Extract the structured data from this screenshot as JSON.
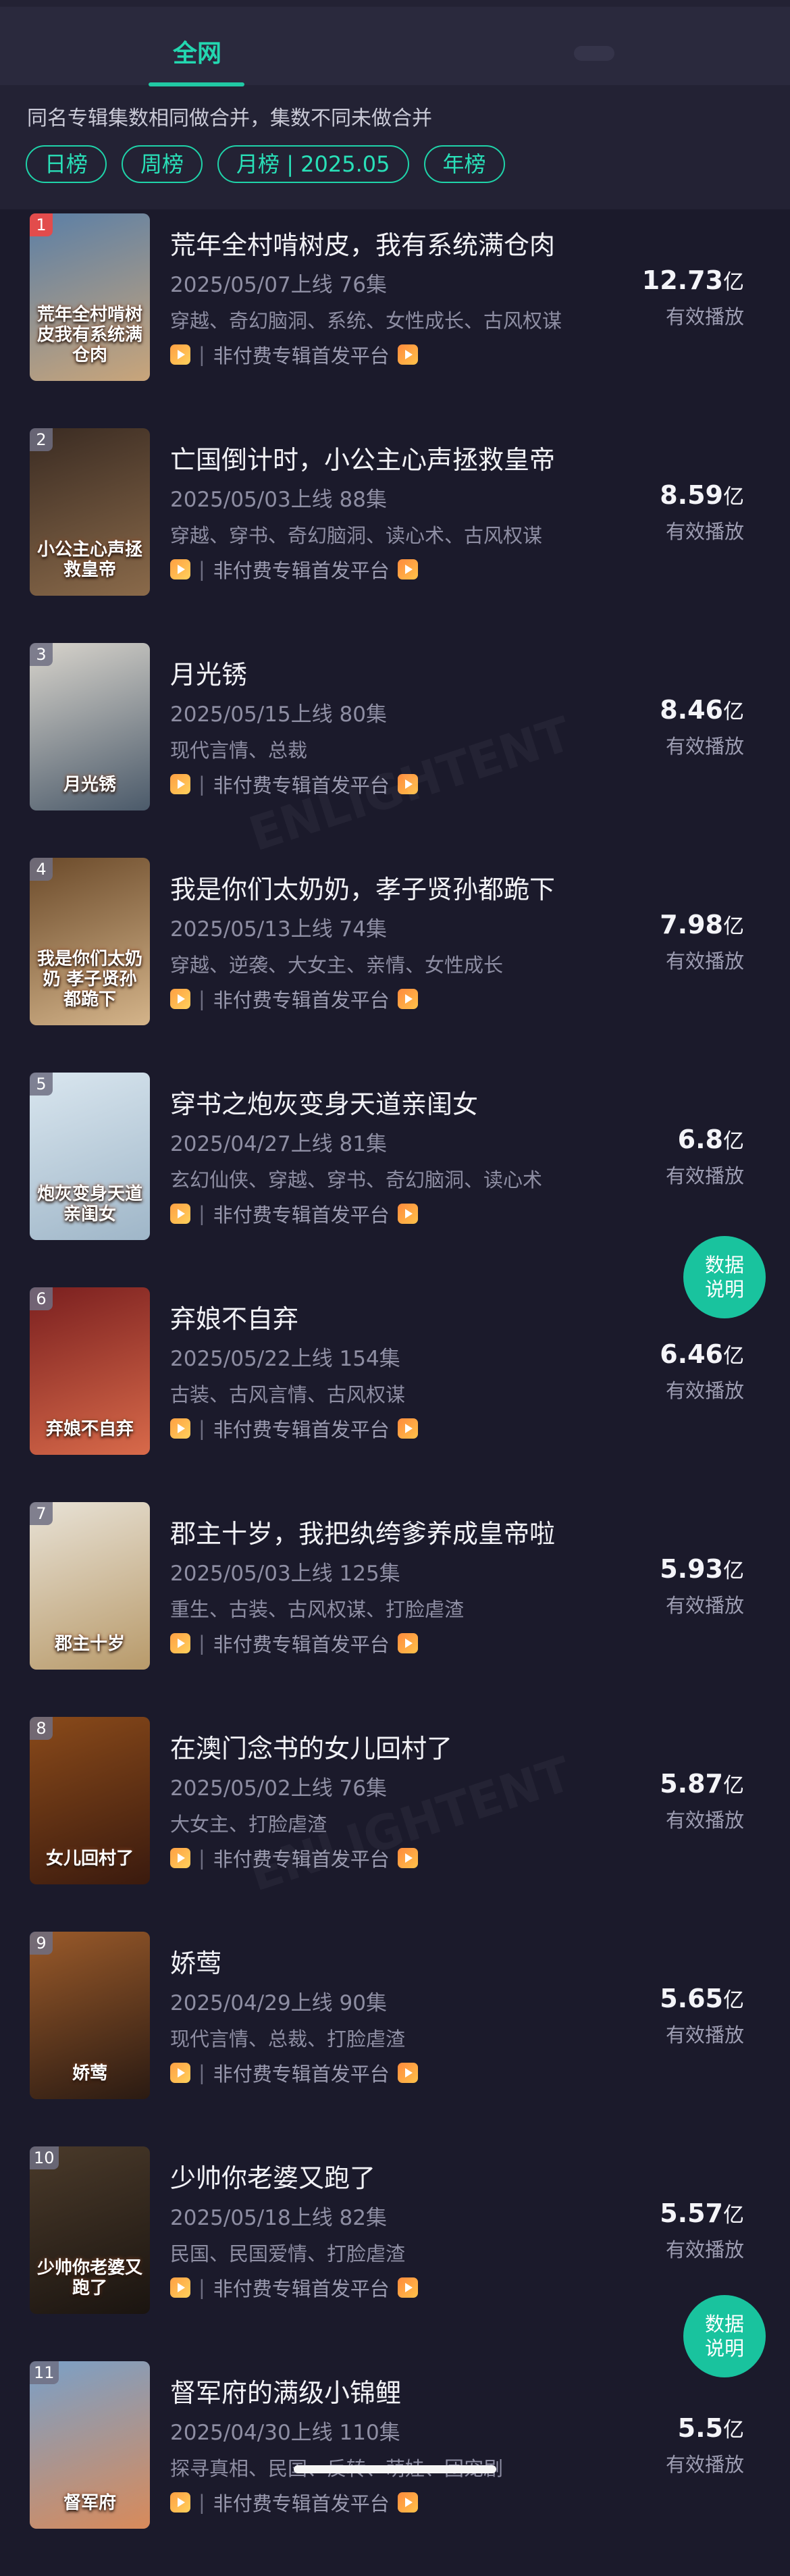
{
  "tabs": {
    "active": "全网"
  },
  "note": "同名专辑集数相同做合并，集数不同未做合并",
  "filters": [
    "日榜",
    "周榜",
    "月榜 | 2025.05",
    "年榜"
  ],
  "fab_label_line1": "数据",
  "fab_label_line2": "说明",
  "platform_text": "非付费专辑首发平台",
  "separator": "|",
  "value_label": "有效播放",
  "unit": "亿",
  "colors": {
    "accent": "#21c9a4",
    "background": "#1b1a2b",
    "header": "#232234",
    "rank_first": "#e24c4c"
  },
  "items": [
    {
      "rank": "1",
      "title": "荒年全村啃树皮，我有系统满仓肉",
      "meta": "2025/05/07上线 76集",
      "tags": "穿越、奇幻脑洞、系统、女性成长、古风权谋",
      "value": "12.73",
      "poster_text": "荒年全村啃树皮我有系统满仓肉",
      "poster_colors": [
        "#5b7fa6",
        "#c9a57a"
      ]
    },
    {
      "rank": "2",
      "title": "亡国倒计时，小公主心声拯救皇帝",
      "meta": "2025/05/03上线 88集",
      "tags": "穿越、穿书、奇幻脑洞、读心术、古风权谋",
      "value": "8.59",
      "poster_text": "小公主心声拯救皇帝",
      "poster_colors": [
        "#3a2b22",
        "#8a6a4a"
      ]
    },
    {
      "rank": "3",
      "title": "月光锈",
      "meta": "2025/05/15上线 80集",
      "tags": "现代言情、总裁",
      "value": "8.46",
      "poster_text": "月光锈",
      "poster_colors": [
        "#d8d4cc",
        "#4b5a6a"
      ]
    },
    {
      "rank": "4",
      "title": "我是你们太奶奶，孝子贤孙都跪下",
      "meta": "2025/05/13上线 74集",
      "tags": "穿越、逆袭、大女主、亲情、女性成长",
      "value": "7.98",
      "poster_text": "我是你们太奶奶 孝子贤孙都跪下",
      "poster_colors": [
        "#6b4a2a",
        "#d4b48a"
      ]
    },
    {
      "rank": "5",
      "title": "穿书之炮灰变身天道亲闺女",
      "meta": "2025/04/27上线 81集",
      "tags": "玄幻仙侠、穿越、穿书、奇幻脑洞、读心术",
      "value": "6.8",
      "poster_text": "炮灰变身天道亲闺女",
      "poster_colors": [
        "#d9e6ef",
        "#9fb6c8"
      ]
    },
    {
      "rank": "6",
      "title": "弃娘不自弃",
      "meta": "2025/05/22上线 154集",
      "tags": "古装、古风言情、古风权谋",
      "value": "6.46",
      "poster_text": "弃娘不自弃",
      "poster_colors": [
        "#7a1f1f",
        "#d86a4a"
      ]
    },
    {
      "rank": "7",
      "title": "郡主十岁，我把纨绔爹养成皇帝啦",
      "meta": "2025/05/03上线 125集",
      "tags": "重生、古装、古风权谋、打脸虐渣",
      "value": "5.93",
      "poster_text": "郡主十岁",
      "poster_colors": [
        "#e8e2d6",
        "#b89a6a"
      ]
    },
    {
      "rank": "8",
      "title": "在澳门念书的女儿回村了",
      "meta": "2025/05/02上线 76集",
      "tags": "大女主、打脸虐渣",
      "value": "5.87",
      "poster_text": "女儿回村了",
      "poster_colors": [
        "#8a4a1a",
        "#3a1a0e"
      ]
    },
    {
      "rank": "9",
      "title": "娇莺",
      "meta": "2025/04/29上线 90集",
      "tags": "现代言情、总裁、打脸虐渣",
      "value": "5.65",
      "poster_text": "娇莺",
      "poster_colors": [
        "#9a5a2a",
        "#2a1a12"
      ]
    },
    {
      "rank": "10",
      "title": "少帅你老婆又跑了",
      "meta": "2025/05/18上线 82集",
      "tags": "民国、民国爱情、打脸虐渣",
      "value": "5.57",
      "poster_text": "少帅你老婆又跑了",
      "poster_colors": [
        "#4a3a2a",
        "#1a1410"
      ]
    },
    {
      "rank": "11",
      "title": "督军府的满级小锦鲤",
      "meta": "2025/04/30上线 110集",
      "tags": "探寻真相、民国、反转、萌娃、团宠剧",
      "value": "5.5",
      "poster_text": "督军府",
      "poster_colors": [
        "#7aa0c8",
        "#d88a5a"
      ]
    }
  ]
}
